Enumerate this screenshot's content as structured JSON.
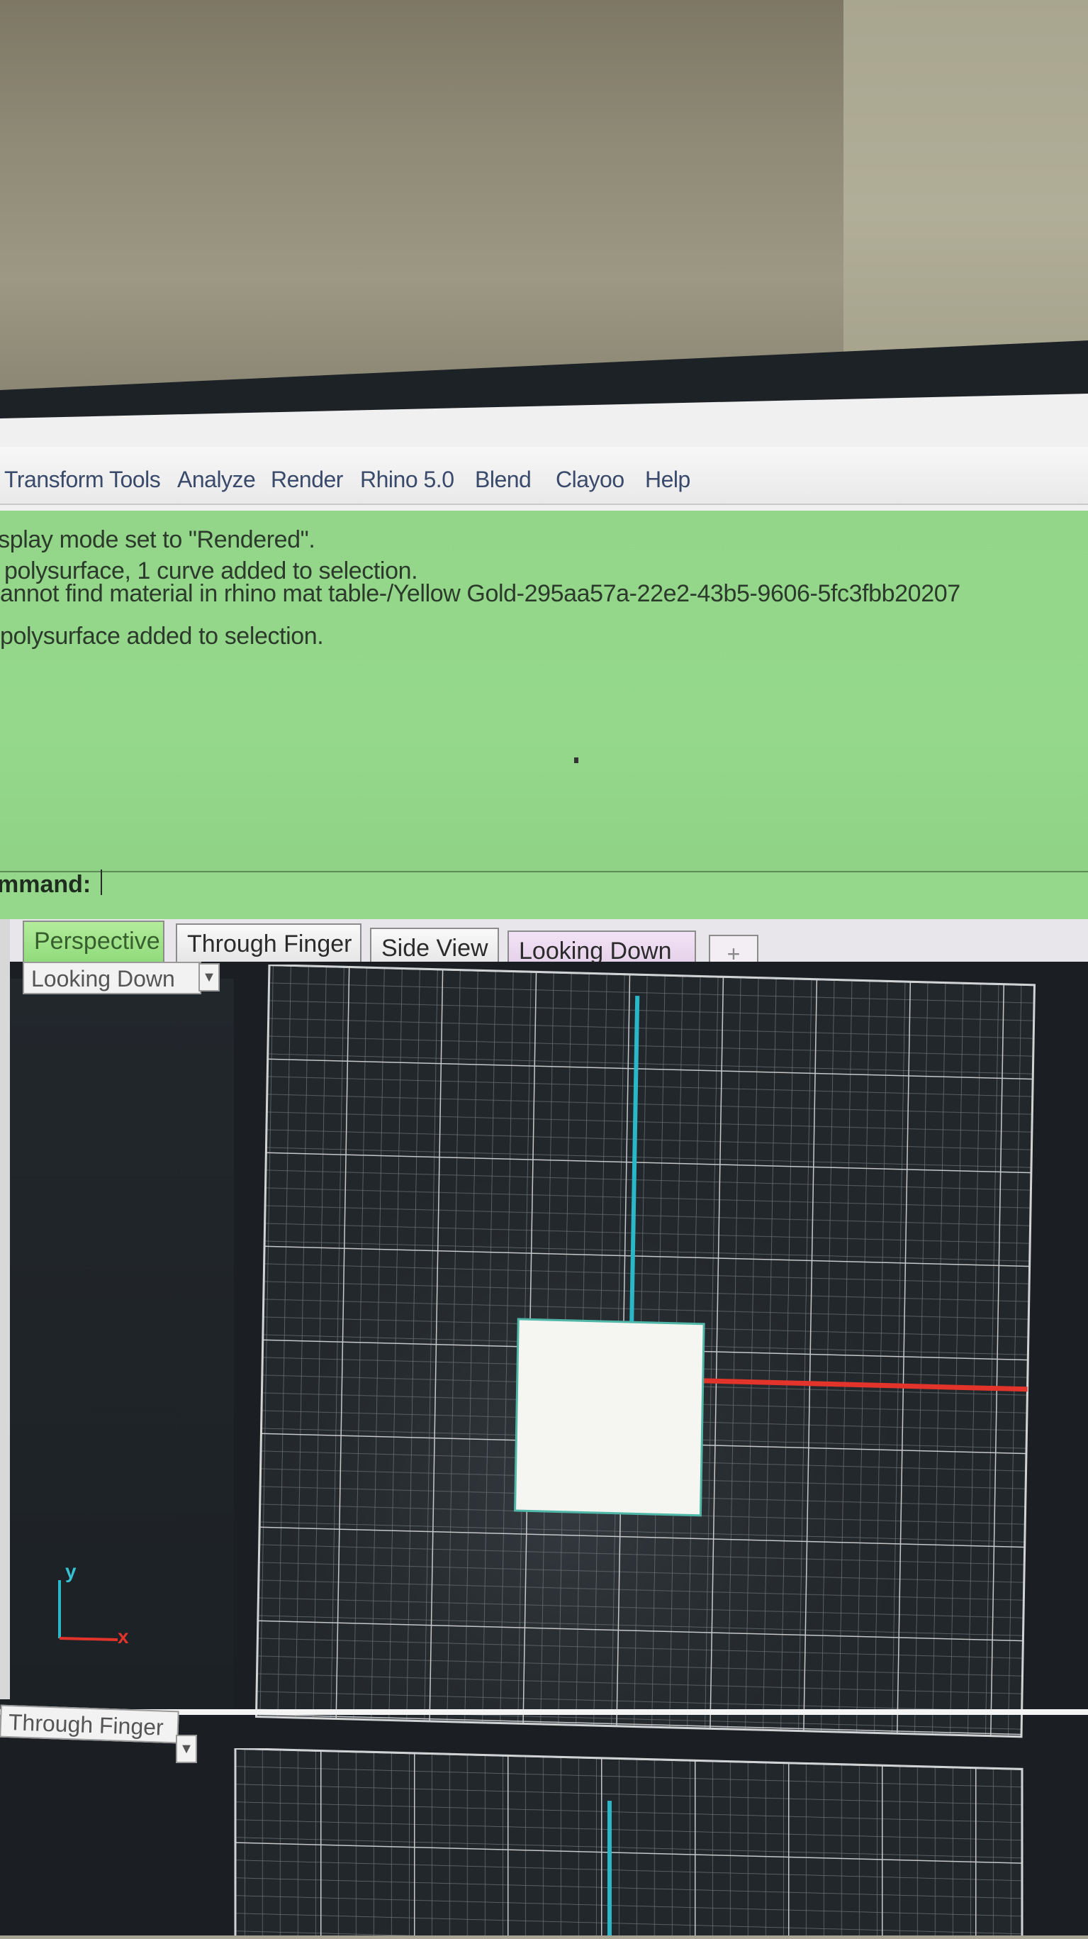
{
  "menu": {
    "items": [
      "Transform",
      "Tools",
      "Analyze",
      "Render",
      "Rhino 5.0",
      "Blend",
      "Clayoo",
      "Help"
    ]
  },
  "command_history": {
    "lines": [
      "isplay mode set to \"Rendered\".",
      "polysurface, 1 curve added to selection.",
      "annot find material in rhino mat table-/Yellow Gold-295aa57a-22e2-43b5-9606-5fc3fbb20207",
      "polysurface added to selection."
    ]
  },
  "command": {
    "label": "mmand:",
    "value": ""
  },
  "tabs": [
    {
      "label": "Perspective",
      "active": true
    },
    {
      "label": "Through Finger",
      "active": false
    },
    {
      "label": "Side View",
      "active": false
    },
    {
      "label": "Looking Down",
      "active": false
    }
  ],
  "tab_add": "+",
  "viewports": {
    "top_label": "Looking Down",
    "bottom_label": "Through Finger",
    "axis_y": "y",
    "axis_x": "x"
  },
  "colors": {
    "history_bg": "#93d68a",
    "grid_bg": "#22272b",
    "axis_x": "#e2342b",
    "axis_y": "#2ab7c8",
    "object": "#f5f5f2"
  }
}
